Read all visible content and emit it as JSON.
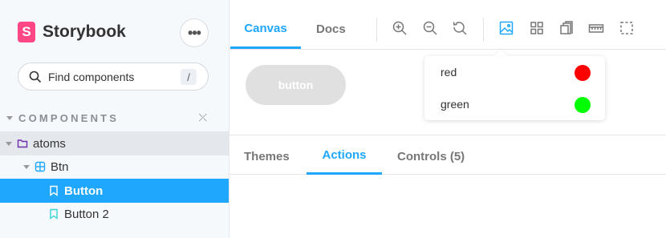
{
  "sidebar": {
    "brand_logo": "S",
    "brand_name": "Storybook",
    "menu_label": "•••",
    "search": {
      "placeholder": "Find components",
      "shortcut": "/"
    },
    "section_label": "COMPONENTS",
    "tree": [
      {
        "label": "atoms",
        "icon": "folder-icon"
      },
      {
        "label": "Btn",
        "icon": "component-icon"
      },
      {
        "label": "Button",
        "icon": "bookmark-icon",
        "selected": true
      },
      {
        "label": "Button 2",
        "icon": "bookmark-icon"
      }
    ]
  },
  "toolbar": {
    "tabs": [
      {
        "label": "Canvas",
        "active": true
      },
      {
        "label": "Docs"
      }
    ],
    "tools": [
      "zoom-in-icon",
      "zoom-out-icon",
      "zoom-reset-icon",
      "background-image-icon",
      "grid-icon",
      "viewport-icon",
      "ruler-icon",
      "outline-icon"
    ]
  },
  "preview": {
    "button_label": "button"
  },
  "backgrounds_popover": {
    "items": [
      {
        "label": "red",
        "color": "#ff0000"
      },
      {
        "label": "green",
        "color": "#00ff00"
      }
    ]
  },
  "addons": {
    "tabs": [
      {
        "label": "Themes"
      },
      {
        "label": "Actions",
        "active": true
      },
      {
        "label": "Controls (5)"
      }
    ]
  },
  "colors": {
    "accent": "#1ea7fd",
    "brand": "#ff4785"
  }
}
